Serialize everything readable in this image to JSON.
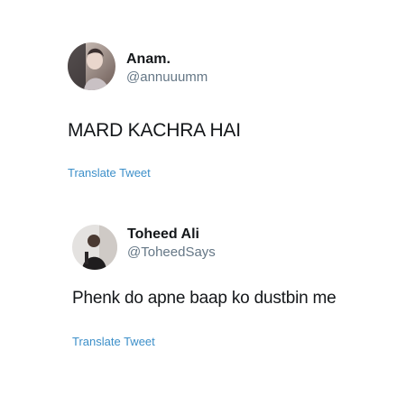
{
  "tweets": [
    {
      "display_name": "Anam.",
      "handle": "@annuuumm",
      "text": "MARD KACHRA HAI",
      "translate_label": "Translate Tweet"
    },
    {
      "display_name": "Toheed Ali",
      "handle": "@ToheedSays",
      "text": "Phenk do apne baap ko dustbin me",
      "translate_label": "Translate Tweet"
    }
  ],
  "colors": {
    "text": "#14171a",
    "handle": "#657786",
    "link": "#3c8fc9",
    "background": "#ffffff"
  }
}
